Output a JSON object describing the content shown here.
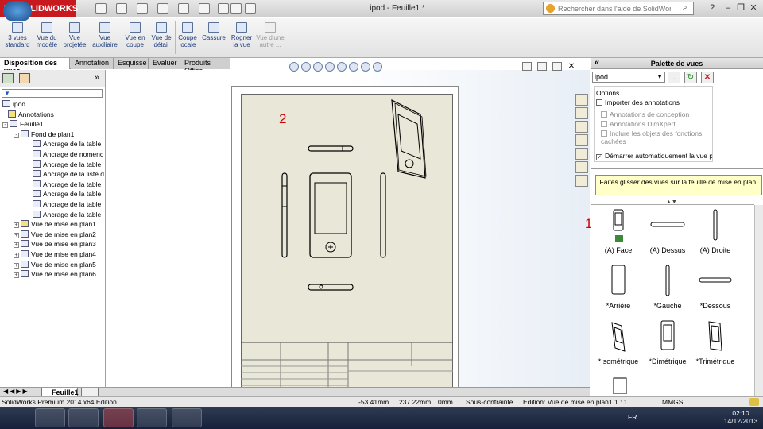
{
  "app": {
    "brand": "SOLIDWORKS",
    "title": "ipod - Feuille1 *"
  },
  "search": {
    "placeholder": "Rechercher dans l'aide de SolidWorks"
  },
  "commands": [
    {
      "label": "3 vues standard"
    },
    {
      "label": "Vue du modèle"
    },
    {
      "label": "Vue projetée"
    },
    {
      "label": "Vue auxiliaire"
    },
    {
      "label": "Vue en coupe"
    },
    {
      "label": "Vue de détail"
    },
    {
      "label": "Coupe locale"
    },
    {
      "label": "Cassure"
    },
    {
      "label": "Rogner la vue"
    },
    {
      "label": "Vue d'une autre ..."
    }
  ],
  "tabs": [
    "Disposition des vues",
    "Annotation",
    "Esquisse",
    "Evaluer",
    "Produits Office"
  ],
  "tree": {
    "root": "ipod",
    "nodes": [
      "Annotations",
      "Feuille1",
      "Fond de plan1",
      "Ancrage de la table",
      "Ancrage de nomenc",
      "Ancrage de la table",
      "Ancrage de la liste d",
      "Ancrage de la table",
      "Ancrage de la table",
      "Ancrage de la table",
      "Ancrage de la table",
      "Vue de mise en plan1",
      "Vue de mise en plan2",
      "Vue de mise en plan3",
      "Vue de mise en plan4",
      "Vue de mise en plan5",
      "Vue de mise en plan6"
    ]
  },
  "drawing": {
    "sheet_number": "2",
    "marker": "1"
  },
  "palette": {
    "title": "Palette de vues",
    "document": "ipod",
    "options_title": "Options",
    "import_annotations": "Importer des annotations",
    "design_annotations": "Annotations de conception",
    "dimxpert_annotations": "Annotations DimXpert",
    "include_hidden": "Inclure les objets des fonctions cachées",
    "auto_start": "Démarrer automatiquement la vue pr",
    "tip": "Faites glisser des vues sur la feuille de mise en plan.",
    "views": [
      "(A) Face",
      "(A) Dessus",
      "(A) Droite",
      "*Arrière",
      "*Gauche",
      "*Dessous",
      "*Isométrique",
      "*Dimétrique",
      "*Trimétrique"
    ]
  },
  "sheet_tab": "Feuille1",
  "status": {
    "product": "SolidWorks Premium 2014 x64 Edition",
    "x": "-53.41mm",
    "y": "237.22mm",
    "z": "0mm",
    "state": "Sous-contrainte",
    "mode": "Edition: Vue de mise en plan1",
    "scale": "1 : 1",
    "units": "MMGS"
  },
  "taskbar": {
    "lang": "FR",
    "time": "02:10",
    "date": "14/12/2013"
  }
}
